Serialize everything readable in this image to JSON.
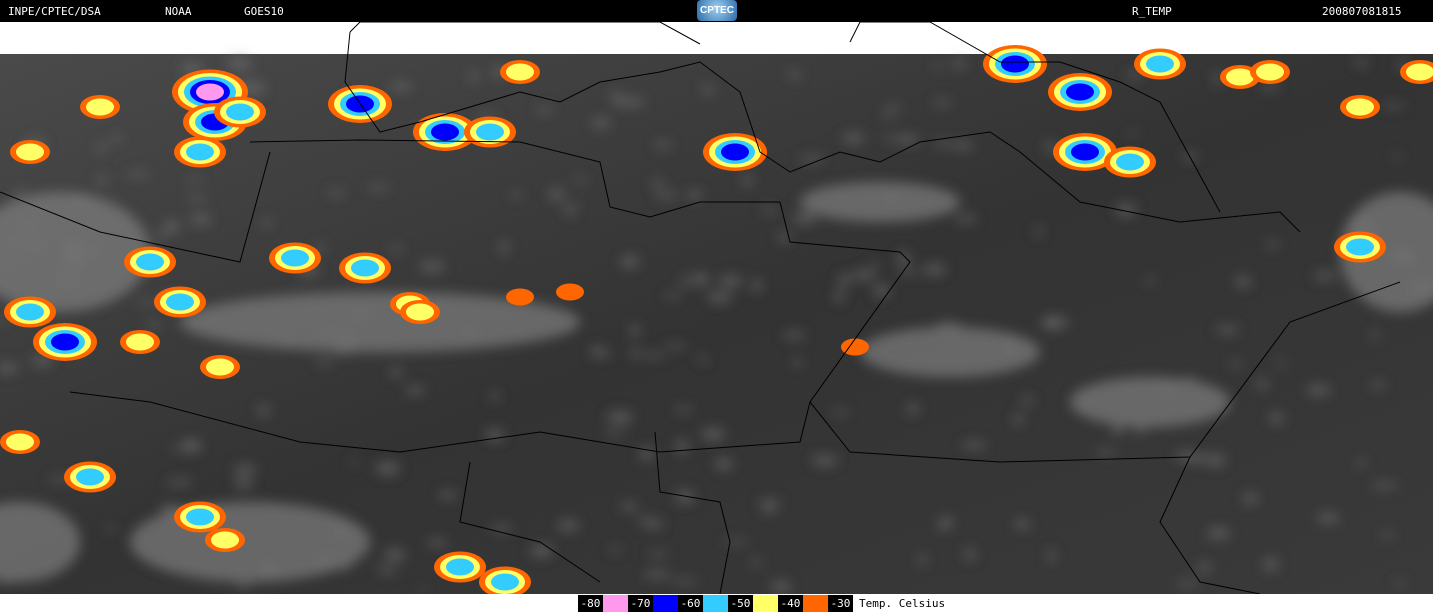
{
  "header": {
    "source": "INPE/CPTEC/DSA",
    "agency": "NOAA",
    "satellite": "GOES10",
    "logo_text": "CPTEC",
    "product": "R_TEMP",
    "timestamp": "200807081815"
  },
  "legend": {
    "unit": "Temp. Celsius",
    "items": [
      {
        "label": "-80",
        "color": "#ff99ee"
      },
      {
        "label": "-70",
        "color": "#0000ff"
      },
      {
        "label": "-60",
        "color": "#33ccff"
      },
      {
        "label": "-50",
        "color": "#ffff66"
      },
      {
        "label": "-40",
        "color": "#ff6600"
      },
      {
        "label": "-30",
        "color": null
      }
    ]
  }
}
